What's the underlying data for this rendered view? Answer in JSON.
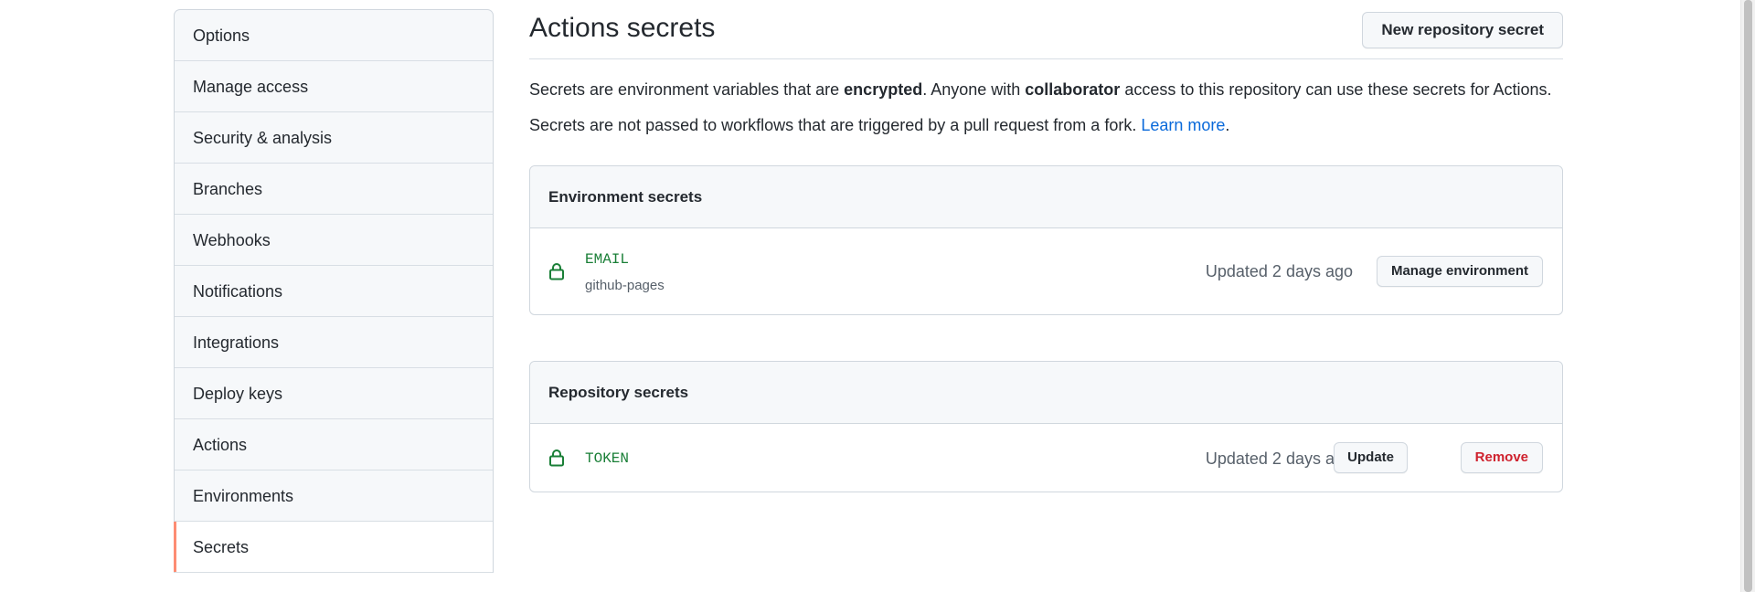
{
  "sidebar": {
    "items": [
      {
        "label": "Options"
      },
      {
        "label": "Manage access"
      },
      {
        "label": "Security & analysis"
      },
      {
        "label": "Branches"
      },
      {
        "label": "Webhooks"
      },
      {
        "label": "Notifications"
      },
      {
        "label": "Integrations"
      },
      {
        "label": "Deploy keys"
      },
      {
        "label": "Actions"
      },
      {
        "label": "Environments"
      },
      {
        "label": "Secrets"
      }
    ],
    "selected": "Secrets"
  },
  "main": {
    "title": "Actions secrets",
    "new_secret_button": "New repository secret",
    "description_line1": {
      "part1": "Secrets are environment variables that are ",
      "bold1": "encrypted",
      "part2": ". Anyone with ",
      "bold2": "collaborator",
      "part3": " access to this repository can use these secrets for Actions."
    },
    "description_line2": {
      "text": "Secrets are not passed to workflows that are triggered by a pull request from a fork. ",
      "link": "Learn more",
      "suffix": "."
    },
    "environment_secrets": {
      "header": "Environment secrets",
      "rows": [
        {
          "name": "EMAIL",
          "environment": "github-pages",
          "updated": "Updated 2 days ago",
          "action_label": "Manage environment"
        }
      ]
    },
    "repository_secrets": {
      "header": "Repository secrets",
      "rows": [
        {
          "name": "TOKEN",
          "updated": "Updated 2 days ago",
          "update_label": "Update",
          "remove_label": "Remove"
        }
      ]
    }
  },
  "icons": {
    "secret_icon": "lock-icon"
  },
  "colors": {
    "accent_link": "#0969da",
    "secret_name": "#1a7f37",
    "danger": "#cf222e",
    "selected_indicator": "#fd8c73"
  }
}
